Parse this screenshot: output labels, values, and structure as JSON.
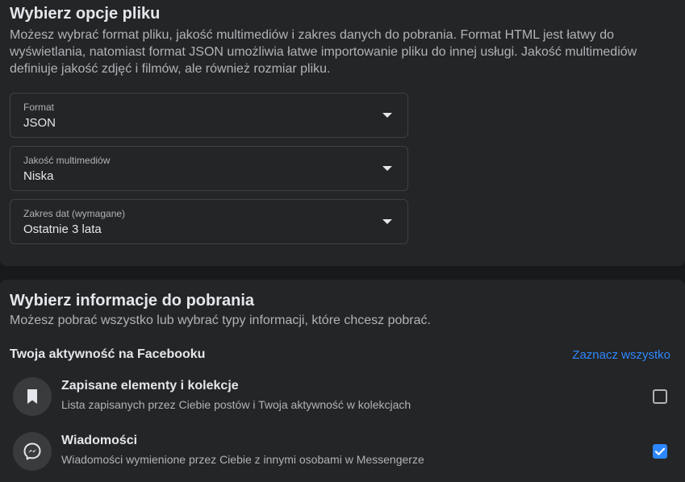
{
  "file_options": {
    "title": "Wybierz opcje pliku",
    "description": "Możesz wybrać format pliku, jakość multimediów i zakres danych do pobrania. Format HTML jest łatwy do wyświetlania, natomiast format JSON umożliwia łatwe importowanie pliku do innej usługi. Jakość multimediów definiuje jakość zdjęć i filmów, ale również rozmiar pliku.",
    "selects": [
      {
        "label": "Format",
        "value": "JSON"
      },
      {
        "label": "Jakość multimediów",
        "value": "Niska"
      },
      {
        "label": "Zakres dat (wymagane)",
        "value": "Ostatnie 3 lata"
      }
    ]
  },
  "info_section": {
    "title": "Wybierz informacje do pobrania",
    "description": "Możesz pobrać wszystko lub wybrać typy informacji, które chcesz pobrać.",
    "activity_heading": "Twoja aktywność na Facebooku",
    "select_all_label": "Zaznacz wszystko",
    "items": [
      {
        "name": "Zapisane elementy i kolekcje",
        "description": "Lista zapisanych przez Ciebie postów i Twoja aktywność w kolekcjach",
        "icon": "bookmark-icon",
        "checked": false
      },
      {
        "name": "Wiadomości",
        "description": "Wiadomości wymienione przez Ciebie z innymi osobami w Messengerze",
        "icon": "messenger-icon",
        "checked": true
      }
    ]
  },
  "colors": {
    "background": "#18191a",
    "card": "#242526",
    "accent": "#2d88ff",
    "primary_text": "#e4e6eb",
    "secondary_text": "#b0b3b8"
  }
}
